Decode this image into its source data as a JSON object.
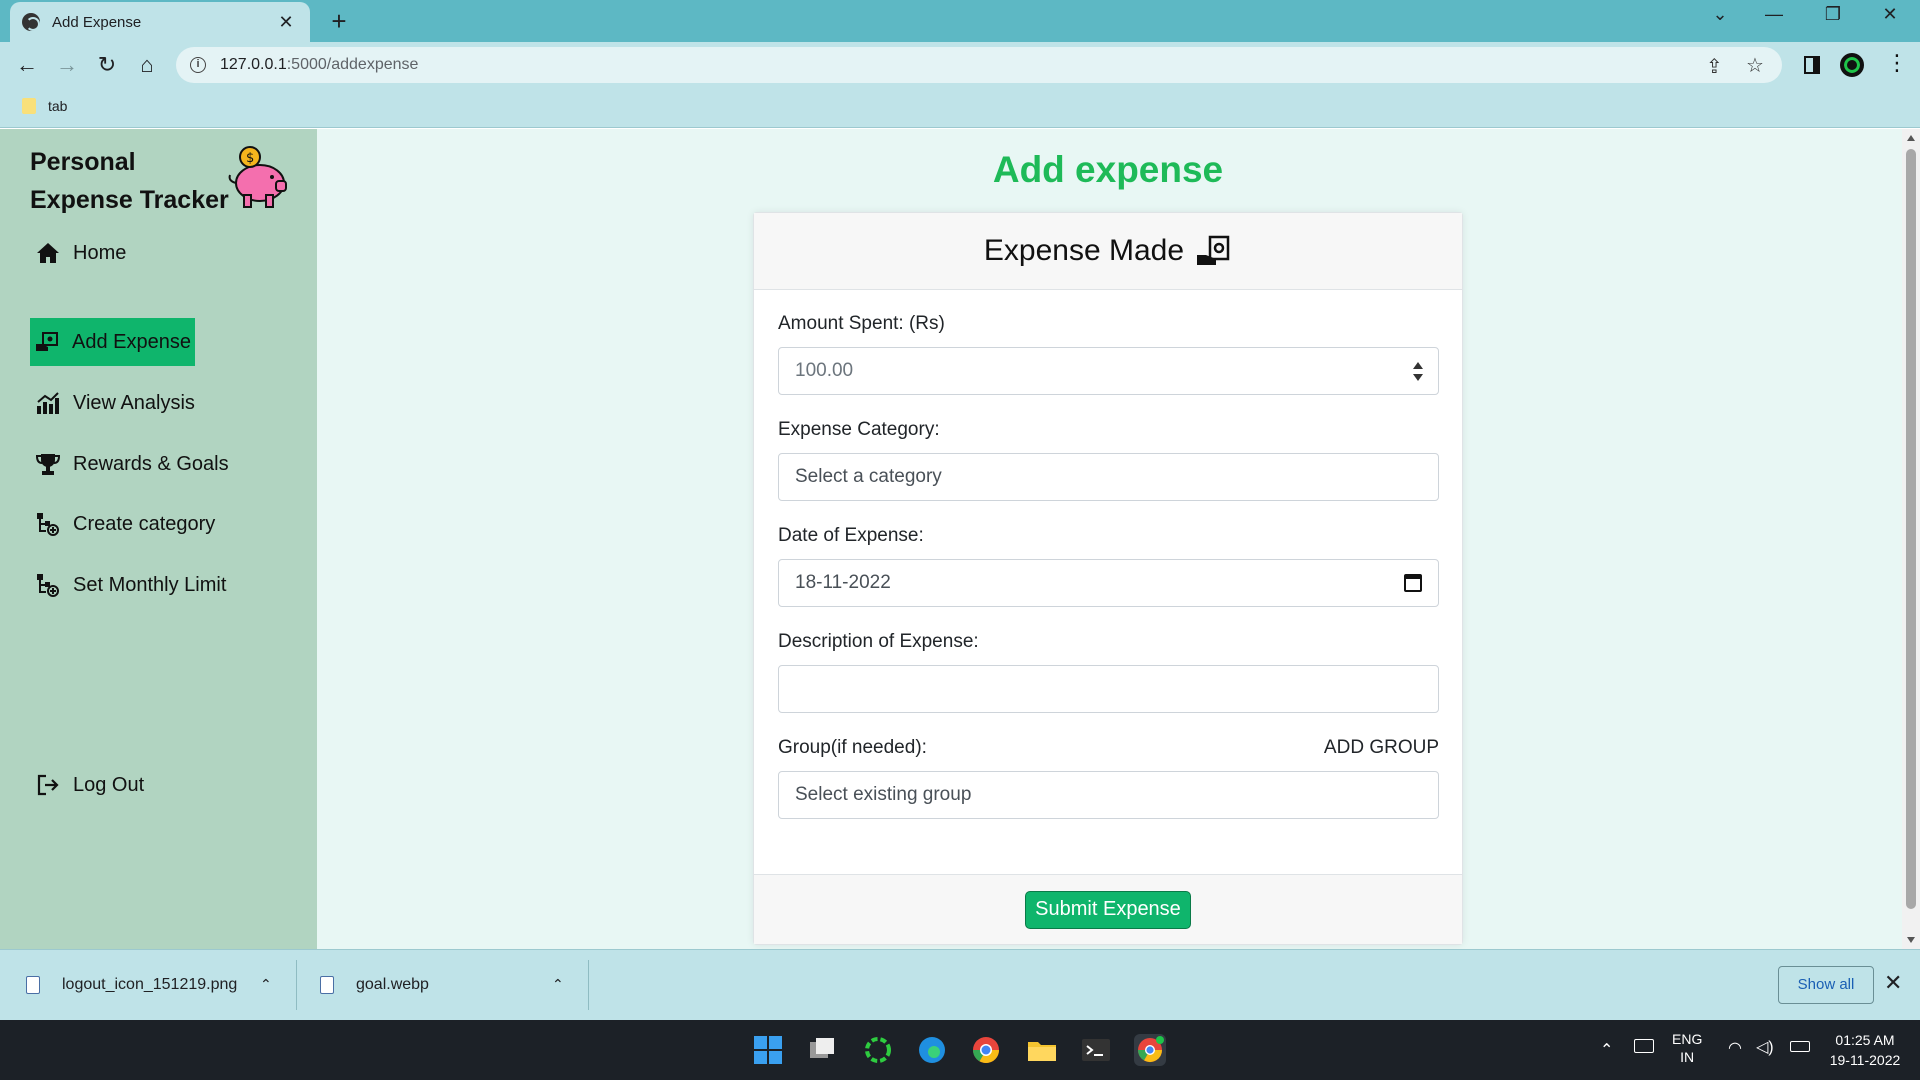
{
  "browser": {
    "tab_title": "Add Expense",
    "tab_close": "✕",
    "new_tab": "+",
    "url_host": "127.0.0.1",
    "url_path": ":5000/addexpense",
    "bookmark": "tab",
    "win_controls": {
      "dropdown": "⌄",
      "minimize": "—",
      "restore": "❐",
      "close": "✕"
    }
  },
  "sidebar": {
    "brand_line1": "Personal",
    "brand_line2": "Expense Tracker",
    "items": [
      {
        "label": "Home",
        "icon": "home-icon"
      },
      {
        "label": "Add Expense",
        "icon": "money-hand-icon",
        "active": true
      },
      {
        "label": "View Analysis",
        "icon": "chart-icon"
      },
      {
        "label": "Rewards & Goals",
        "icon": "trophy-icon"
      },
      {
        "label": "Create category",
        "icon": "category-icon"
      },
      {
        "label": "Set Monthly Limit",
        "icon": "category-icon"
      }
    ],
    "logout": "Log Out"
  },
  "main": {
    "title": "Add expense",
    "card_header": "Expense Made",
    "fields": {
      "amount_label": "Amount Spent: (Rs)",
      "amount_value": "100.00",
      "category_label": "Expense Category:",
      "category_value": "Select a category",
      "date_label": "Date of Expense:",
      "date_value": "18-11-2022",
      "description_label": "Description of Expense:",
      "description_value": "",
      "group_label": "Group(if needed):",
      "add_group": "ADD GROUP",
      "group_value": "Select existing group"
    },
    "submit": "Submit Expense"
  },
  "downloads": {
    "items": [
      {
        "name": "logout_icon_151219.png"
      },
      {
        "name": "goal.webp"
      }
    ],
    "chevron": "⌃",
    "show_all": "Show all",
    "close": "✕"
  },
  "taskbar": {
    "lang1": "ENG",
    "lang2": "IN",
    "time": "01:25 AM",
    "date": "19-11-2022"
  },
  "colors": {
    "accent": "#0fb56c",
    "title_green": "#1eba58",
    "sidebar_bg": "#b1d4c1",
    "page_bg": "#e8f7f4",
    "chrome_bg": "#bfe3e8",
    "tabbar_bg": "#5db8c4"
  }
}
